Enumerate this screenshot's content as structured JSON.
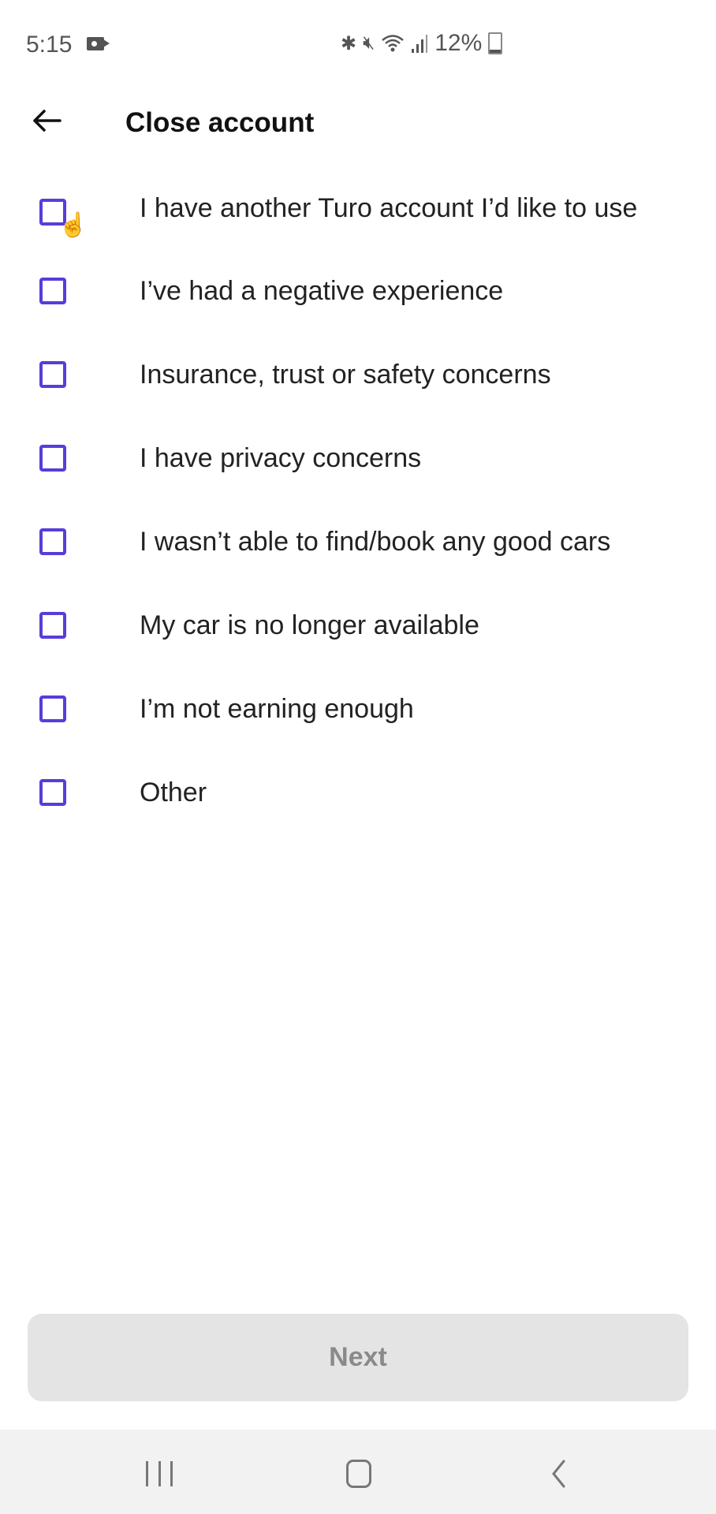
{
  "status_bar": {
    "time": "5:15",
    "battery_percent": "12%",
    "icons": [
      "screen-record-icon",
      "bluetooth-icon",
      "mute-icon",
      "wifi-icon",
      "signal-icon",
      "battery-charging-icon"
    ]
  },
  "header": {
    "back_icon": "arrow-left-icon",
    "title": "Close account"
  },
  "options": [
    {
      "label": "I have another Turo account I’d like to use",
      "checked": false
    },
    {
      "label": "I’ve had a negative experience",
      "checked": false
    },
    {
      "label": "Insurance, trust or safety concerns",
      "checked": false
    },
    {
      "label": "I have privacy concerns",
      "checked": false
    },
    {
      "label": "I wasn’t able to find/book any good cars",
      "checked": false
    },
    {
      "label": "My car is no longer available",
      "checked": false
    },
    {
      "label": "I’m not earning enough",
      "checked": false
    },
    {
      "label": "Other",
      "checked": false
    }
  ],
  "footer": {
    "next_label": "Next",
    "next_enabled": false
  },
  "colors": {
    "accent": "#593cda",
    "button_disabled_bg": "#e4e4e4",
    "button_disabled_text": "#8a8a8a"
  }
}
